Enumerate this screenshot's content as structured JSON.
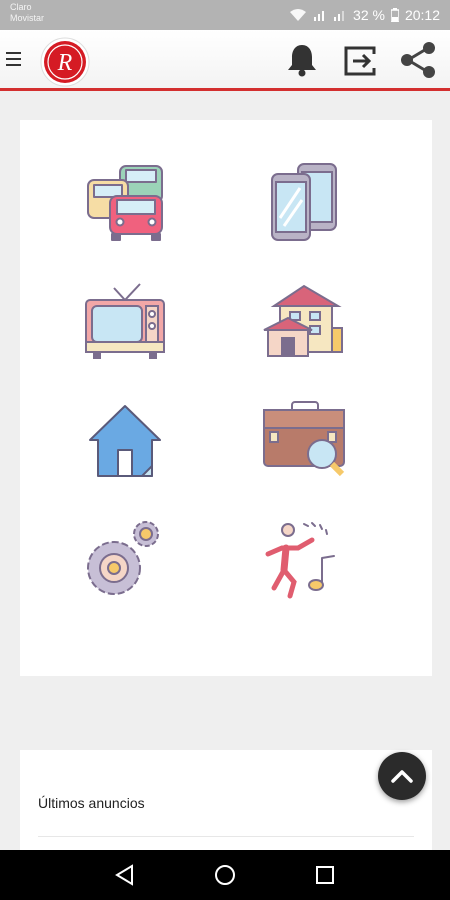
{
  "status_bar": {
    "carrier_line1": "Claro",
    "carrier_line2": "Movistar",
    "battery": "32 %",
    "time": "20:12"
  },
  "toolbar": {
    "logo_letter": "R",
    "icons": [
      "menu-icon",
      "bell-icon",
      "logout-icon",
      "share-icon"
    ]
  },
  "categories": [
    {
      "icon": "cars-icon"
    },
    {
      "icon": "phones-icon"
    },
    {
      "icon": "tv-icon"
    },
    {
      "icon": "buildings-icon"
    },
    {
      "icon": "house-icon"
    },
    {
      "icon": "briefcase-search-icon"
    },
    {
      "icon": "gears-icon"
    },
    {
      "icon": "dance-music-icon"
    }
  ],
  "latest": {
    "title": "Últimos anuncios"
  },
  "colors": {
    "accent": "#d32f2f",
    "fab": "#2b2b2b",
    "outline": "#7b6d8e"
  },
  "nav": [
    "back-icon",
    "home-icon",
    "recents-icon"
  ]
}
